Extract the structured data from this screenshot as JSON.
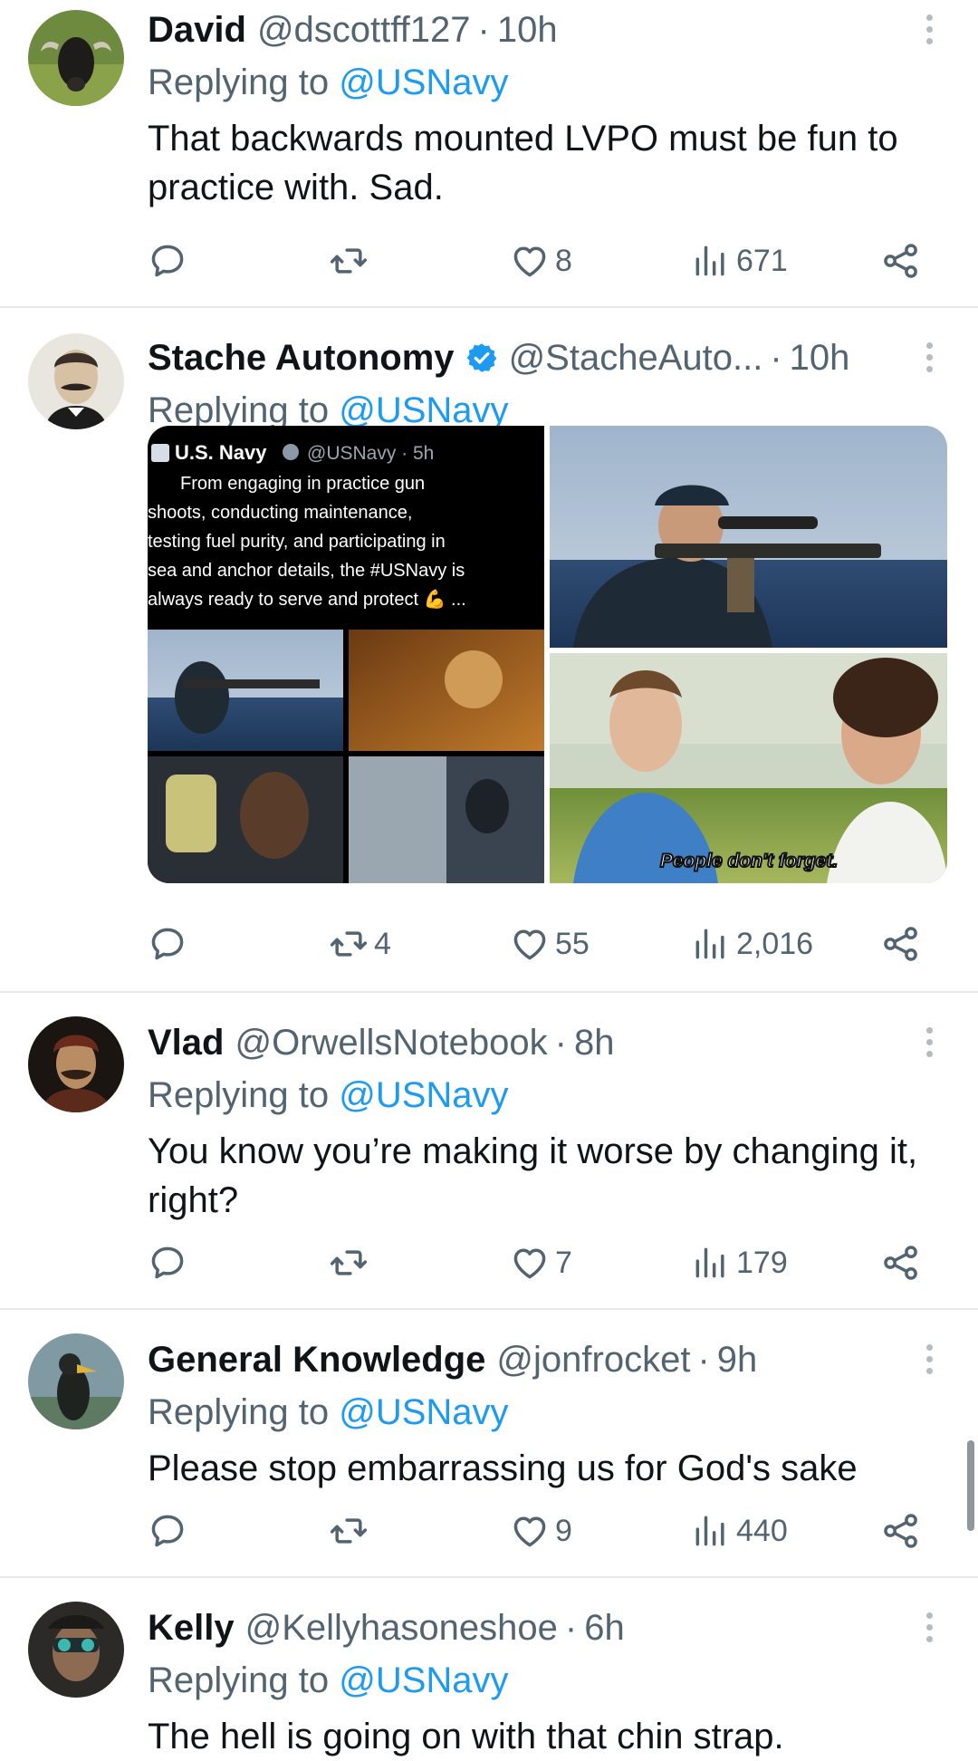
{
  "tweets": [
    {
      "name": "David",
      "handle": "@dscottff127",
      "sep": "·",
      "time": "10h",
      "replying_prefix": "Replying to ",
      "replying_to": "@USNavy",
      "text": "That backwards mounted LVPO must be fun to practice with. Sad.",
      "retweets": "",
      "likes": "8",
      "views": "671"
    },
    {
      "name": "Stache Autonomy",
      "handle": "@StacheAuto...",
      "sep": "·",
      "time": "10h",
      "replying_prefix": "Replying to ",
      "replying_to": "@USNavy",
      "retweets": "4",
      "likes": "55",
      "views": "2,016",
      "media": {
        "embedded_name": "U.S. Navy",
        "embedded_handle": "@USNavy · 5h",
        "embedded_lines": [
          "From engaging in practice gun",
          "shoots, conducting maintenance,",
          "testing fuel purity, and participating in",
          "sea and anchor details, the #USNavy is",
          "always ready to serve and protect 💪 ..."
        ],
        "meme_caption": "People don't forget."
      }
    },
    {
      "name": "Vlad",
      "handle": "@OrwellsNotebook",
      "sep": "·",
      "time": "8h",
      "replying_prefix": "Replying to ",
      "replying_to": "@USNavy",
      "text": "You know you’re making it worse by changing it, right?",
      "retweets": "",
      "likes": "7",
      "views": "179"
    },
    {
      "name": "General Knowledge",
      "handle": "@jonfrocket",
      "sep": "·",
      "time": "9h",
      "replying_prefix": "Replying to ",
      "replying_to": "@USNavy",
      "text": "Please stop embarrassing us for God's sake",
      "retweets": "",
      "likes": "9",
      "views": "440"
    },
    {
      "name": "Kelly",
      "handle": "@Kellyhasoneshoe",
      "sep": "·",
      "time": "6h",
      "replying_prefix": "Replying to ",
      "replying_to": "@USNavy",
      "text": "The hell is going on with that chin strap."
    }
  ],
  "colors": {
    "accent": "#1d9bf0",
    "secondary_text": "#536471",
    "divider": "#e7e9ea"
  },
  "icons": [
    "reply-icon",
    "retweet-icon",
    "like-icon",
    "views-icon",
    "share-icon",
    "more-icon",
    "verified-badge-icon"
  ]
}
